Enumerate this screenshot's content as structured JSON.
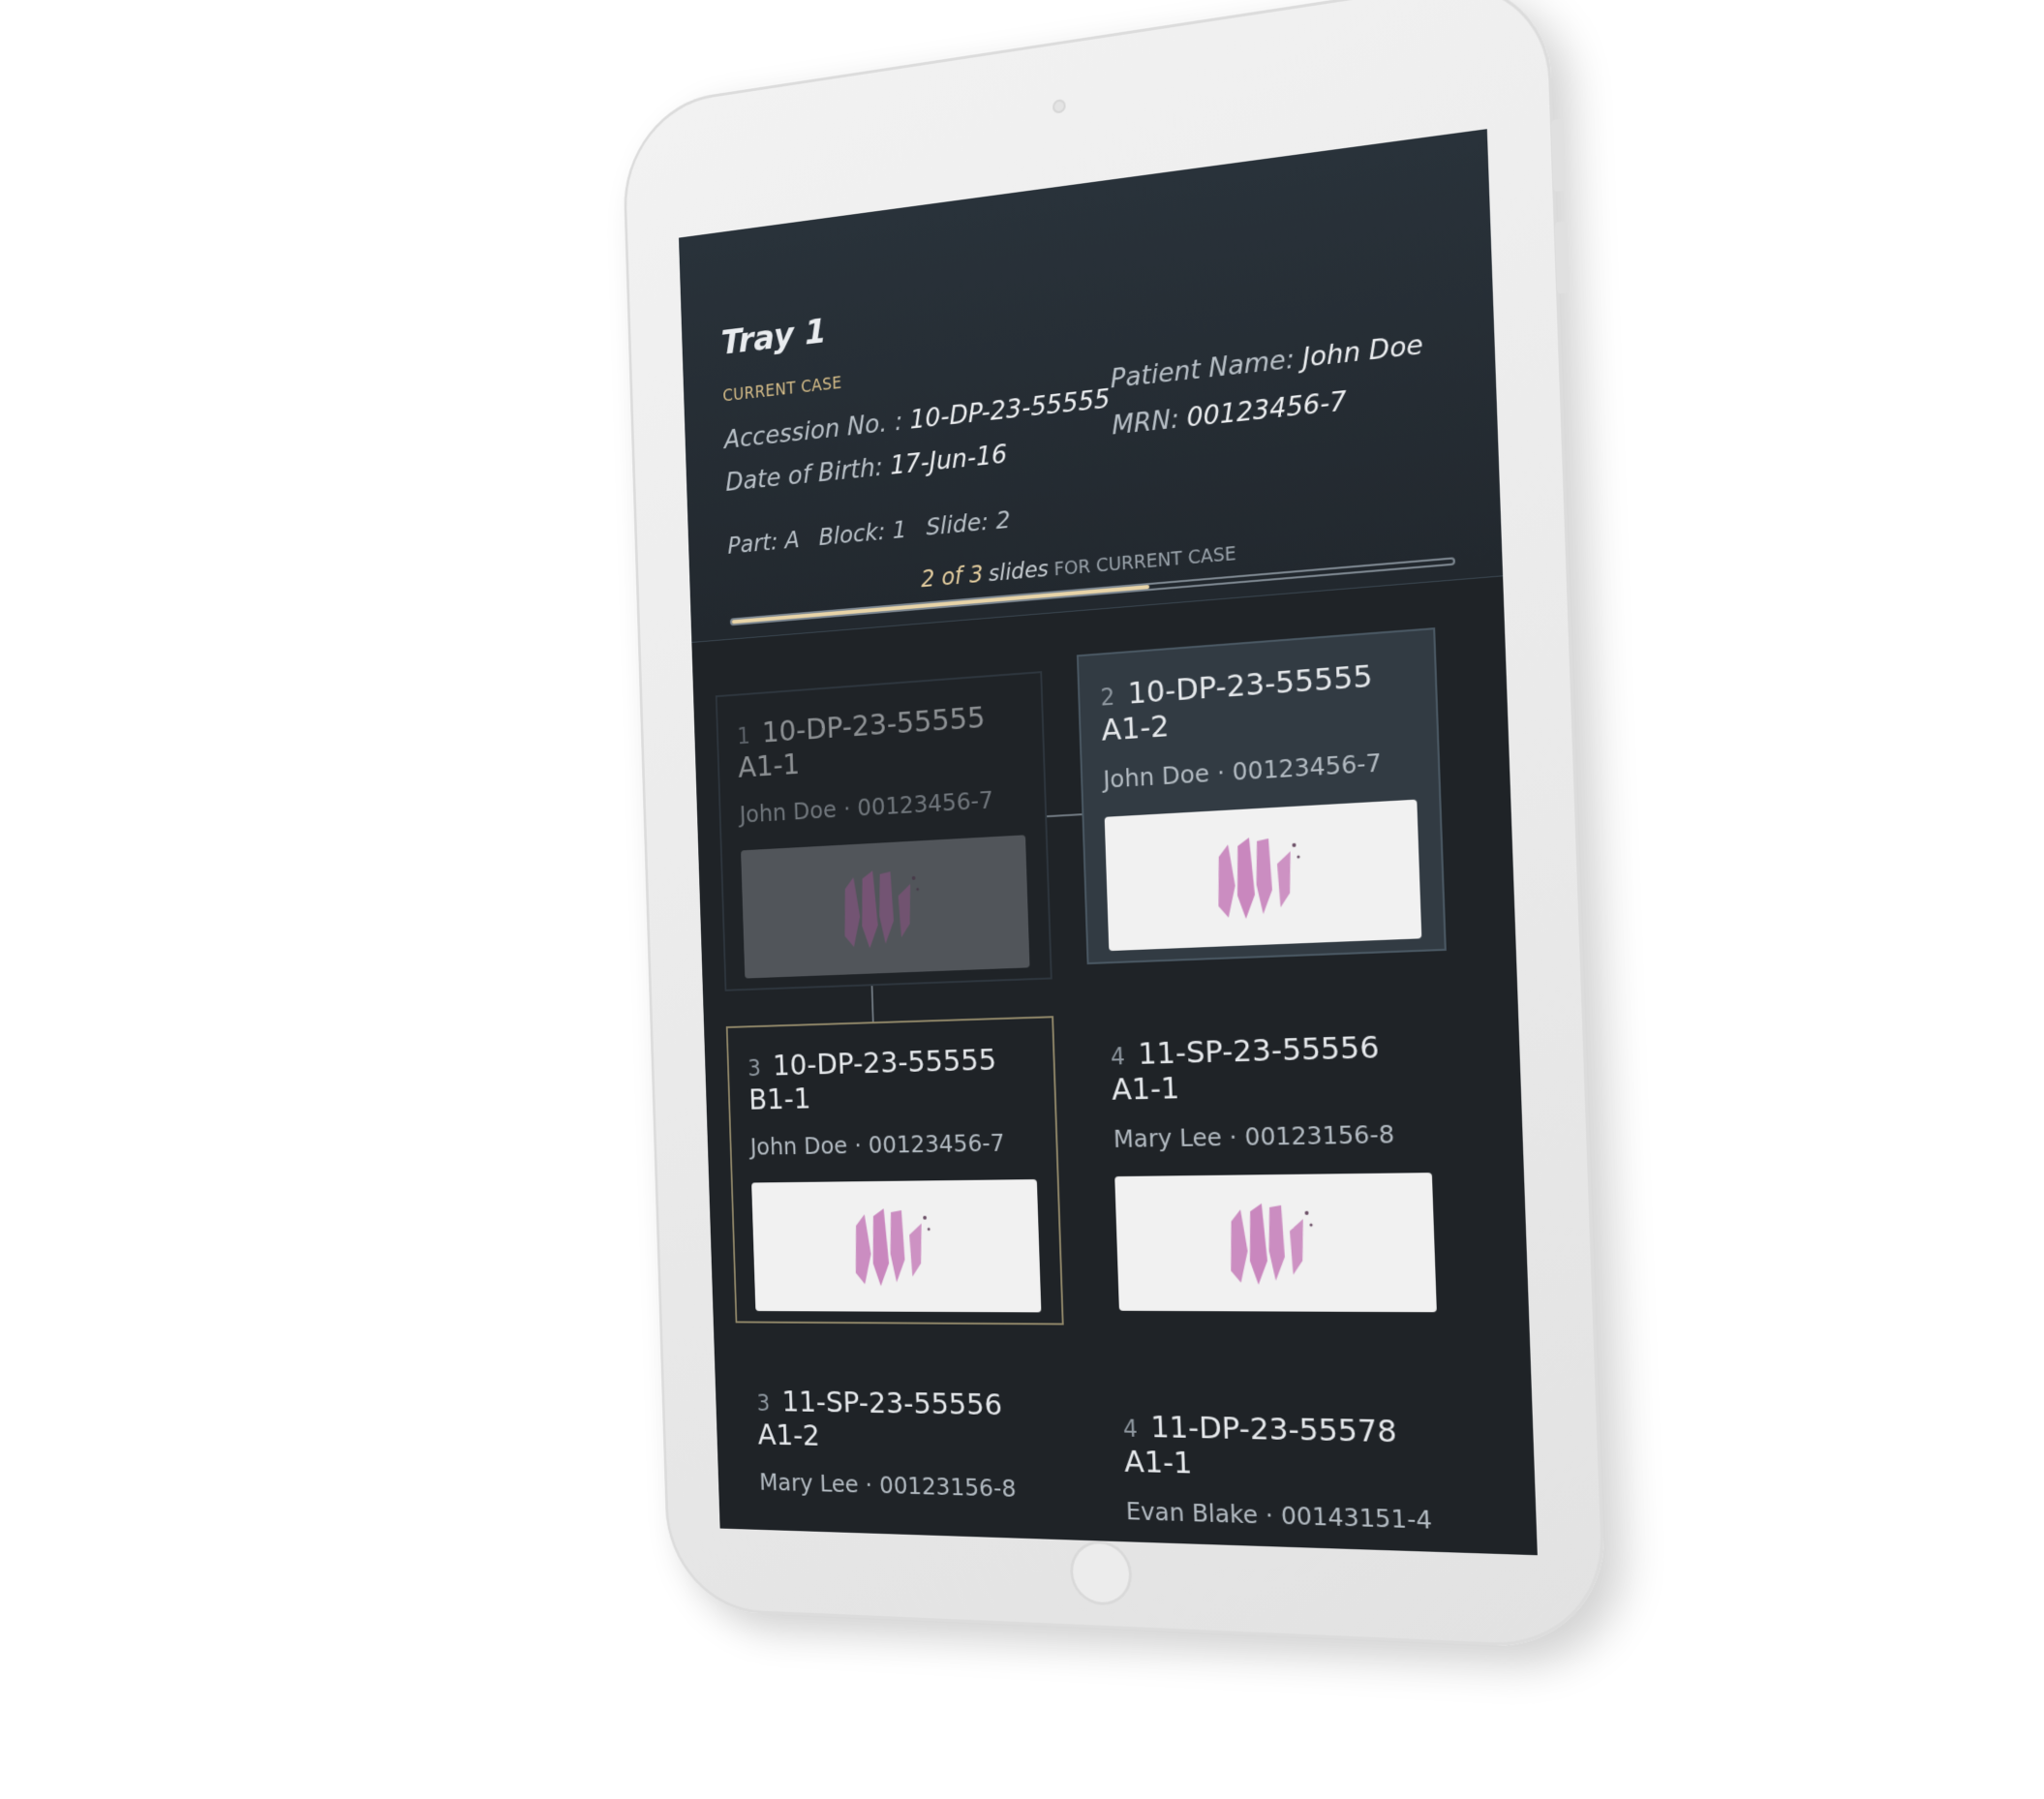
{
  "tray": {
    "title": "Tray 1",
    "current_case_label": "CURRENT CASE",
    "accession_label": "Accession No. :",
    "accession_value": "10-DP-23-55555",
    "dob_label": "Date of Birth:",
    "dob_value": "17-Jun-16",
    "patient_label": "Patient Name:",
    "patient_value": "John Doe",
    "mrn_label": "MRN:",
    "mrn_value": "00123456-7",
    "part_label": "Part: A",
    "block_label": "Block: 1",
    "slide_label": "Slide: 2"
  },
  "progress": {
    "count_text": "2 of 3",
    "slides_text": "slides",
    "suffix_text": "FOR CURRENT CASE",
    "fraction": 0.6
  },
  "cards": [
    {
      "num": "1",
      "accession": "10-DP-23-55555 A1-1",
      "sub": "John Doe · 00123456-7"
    },
    {
      "num": "2",
      "accession": "10-DP-23-55555 A1-2",
      "sub": "John Doe · 00123456-7"
    },
    {
      "num": "3",
      "accession": "10-DP-23-55555 B1-1",
      "sub": "John Doe · 00123456-7"
    },
    {
      "num": "4",
      "accession": "11-SP-23-55556 A1-1",
      "sub": "Mary Lee · 00123156-8"
    },
    {
      "num": "3",
      "accession": "11-SP-23-55556 A1-2",
      "sub": "Mary Lee · 00123156-8"
    },
    {
      "num": "4",
      "accession": "11-DP-23-55578 A1-1",
      "sub": "Evan Blake · 00143151-4"
    }
  ],
  "colors": {
    "screen_bg": "#1f2327",
    "accent_gold": "#e8d4a8",
    "tissue_pink": "#c47bb8"
  },
  "icons": {
    "thumbnail": "tissue-slide-thumbnail-icon"
  }
}
